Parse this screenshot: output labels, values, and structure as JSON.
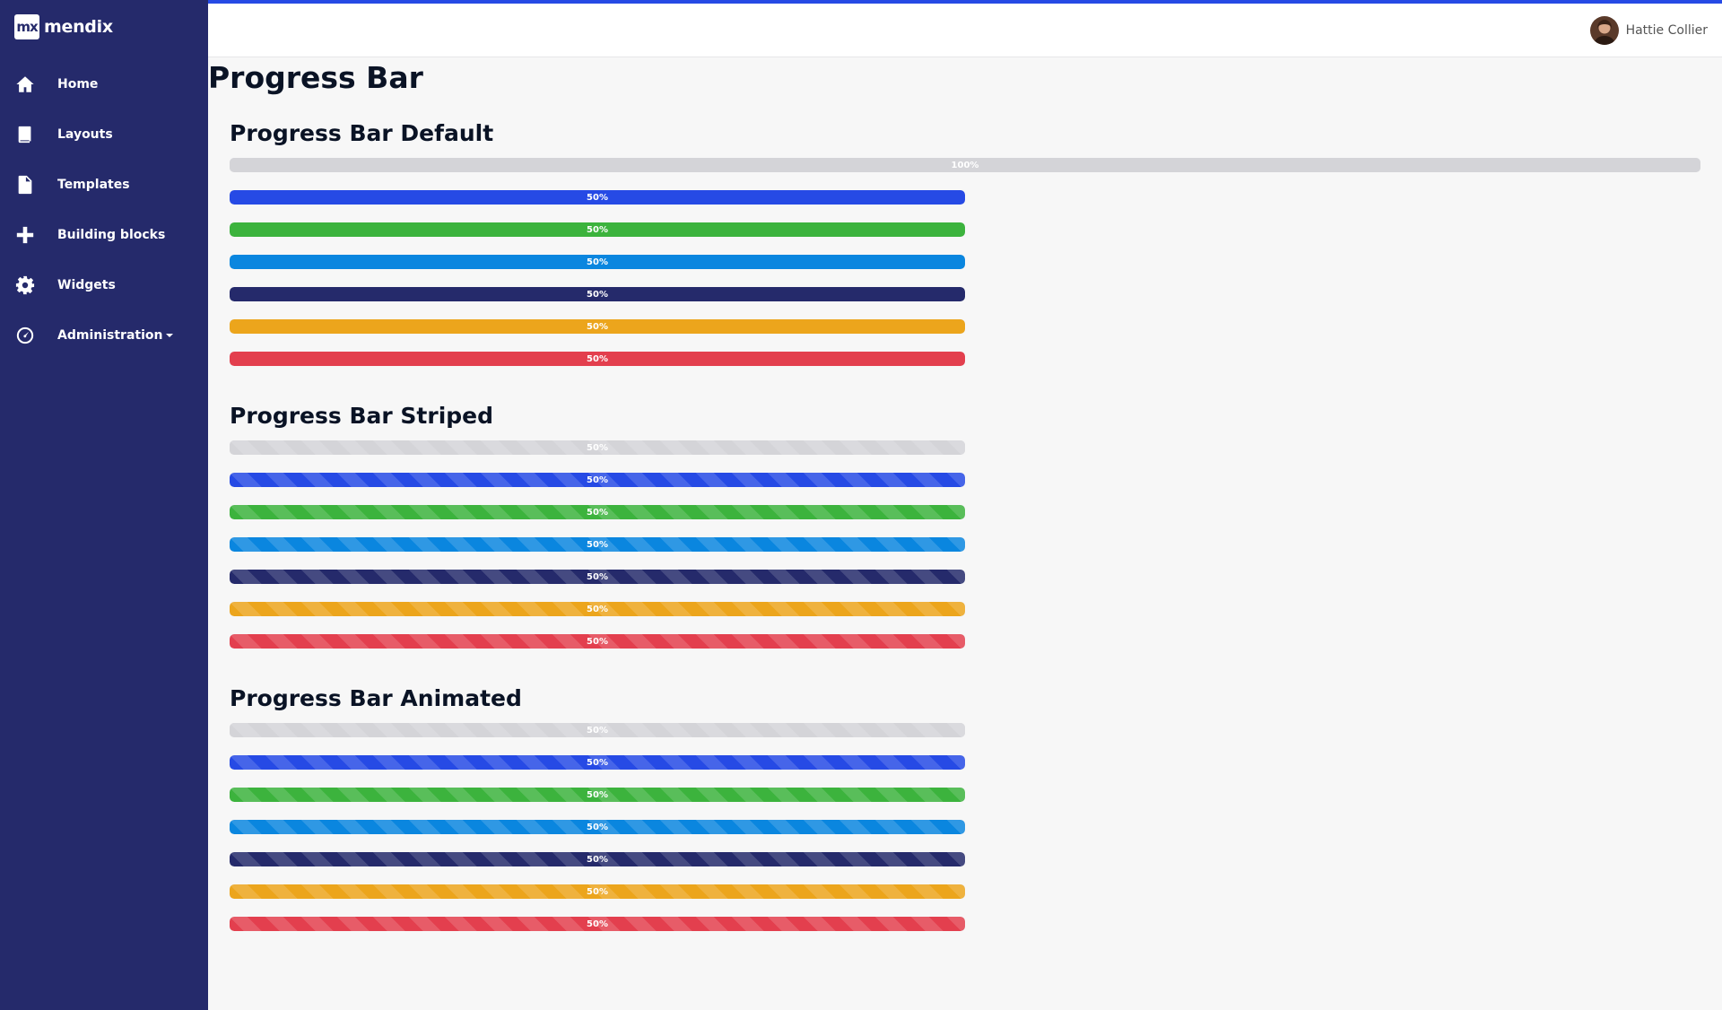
{
  "brand": {
    "logo_text": "mx",
    "name": "mendix"
  },
  "sidebar": {
    "items": [
      {
        "label": "Home",
        "icon": "home-icon"
      },
      {
        "label": "Layouts",
        "icon": "book-icon"
      },
      {
        "label": "Templates",
        "icon": "file-icon"
      },
      {
        "label": "Building blocks",
        "icon": "plus-icon"
      },
      {
        "label": "Widgets",
        "icon": "gear-icon"
      },
      {
        "label": "Administration",
        "icon": "dashboard-icon"
      }
    ]
  },
  "topbar": {
    "user_name": "Hattie Collier"
  },
  "page": {
    "title": "Progress Bar"
  },
  "colors": {
    "sidebar": "#252a6b",
    "accent": "#264ae5",
    "primary": "#264ae5",
    "success": "#3cb33d",
    "info": "#0a86df",
    "inverse": "#252a6b",
    "warning": "#eca51c",
    "danger": "#e33f4e",
    "track": "#d4d4d8"
  },
  "sections": {
    "default": {
      "title": "Progress Bar Default",
      "bars": [
        {
          "label": "100%",
          "value": 1.0,
          "color": "#d4d4d8"
        },
        {
          "label": "50%",
          "value": 1.0,
          "color": "#264ae5"
        },
        {
          "label": "50%",
          "value": 1.0,
          "color": "#3cb33d"
        },
        {
          "label": "50%",
          "value": 1.0,
          "color": "#0a86df"
        },
        {
          "label": "50%",
          "value": 1.0,
          "color": "#252a6b"
        },
        {
          "label": "50%",
          "value": 1.0,
          "color": "#eca51c"
        },
        {
          "label": "50%",
          "value": 1.0,
          "color": "#e33f4e"
        }
      ]
    },
    "striped": {
      "title": "Progress Bar Striped",
      "bars": [
        {
          "label": "50%",
          "value": 1.0,
          "color": "#d4d4d8"
        },
        {
          "label": "50%",
          "value": 1.0,
          "color": "#264ae5"
        },
        {
          "label": "50%",
          "value": 1.0,
          "color": "#3cb33d"
        },
        {
          "label": "50%",
          "value": 1.0,
          "color": "#0a86df"
        },
        {
          "label": "50%",
          "value": 1.0,
          "color": "#252a6b"
        },
        {
          "label": "50%",
          "value": 1.0,
          "color": "#eca51c"
        },
        {
          "label": "50%",
          "value": 1.0,
          "color": "#e33f4e"
        }
      ]
    },
    "animated": {
      "title": "Progress Bar Animated",
      "bars": [
        {
          "label": "50%",
          "value": 1.0,
          "color": "#d4d4d8"
        },
        {
          "label": "50%",
          "value": 1.0,
          "color": "#264ae5"
        },
        {
          "label": "50%",
          "value": 1.0,
          "color": "#3cb33d"
        },
        {
          "label": "50%",
          "value": 1.0,
          "color": "#0a86df"
        },
        {
          "label": "50%",
          "value": 1.0,
          "color": "#252a6b"
        },
        {
          "label": "50%",
          "value": 1.0,
          "color": "#eca51c"
        },
        {
          "label": "50%",
          "value": 1.0,
          "color": "#e33f4e"
        }
      ]
    }
  }
}
